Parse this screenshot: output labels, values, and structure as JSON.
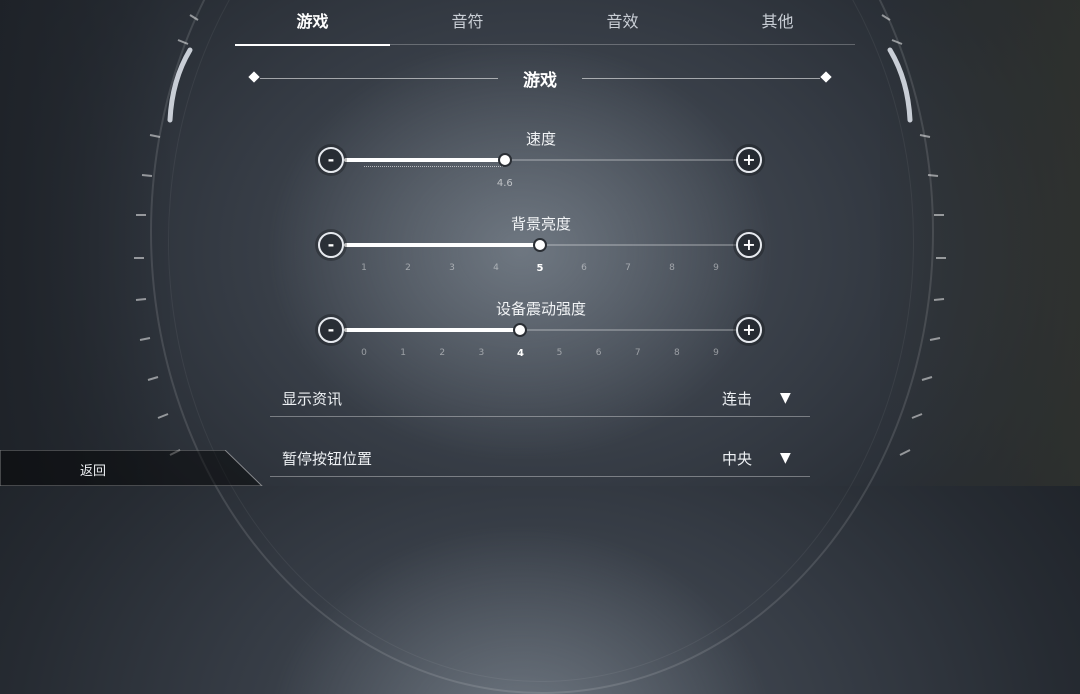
{
  "tabs": [
    {
      "label": "游戏",
      "active": true
    },
    {
      "label": "音符",
      "active": false
    },
    {
      "label": "音效",
      "active": false
    },
    {
      "label": "其他",
      "active": false
    }
  ],
  "section": {
    "title": "游戏"
  },
  "sliders": {
    "speed": {
      "label": "速度",
      "value": 4.6,
      "value_text": "4.6",
      "min": 1,
      "max": 10,
      "minus_label": "-",
      "plus_label": "+"
    },
    "brightness": {
      "label": "背景亮度",
      "value": 5,
      "ticks": [
        "1",
        "2",
        "3",
        "4",
        "5",
        "6",
        "7",
        "8",
        "9"
      ],
      "minus_label": "-",
      "plus_label": "+"
    },
    "vibration": {
      "label": "设备震动强度",
      "value": 4,
      "ticks": [
        "0",
        "1",
        "2",
        "3",
        "4",
        "5",
        "6",
        "7",
        "8",
        "9"
      ],
      "minus_label": "-",
      "plus_label": "+"
    }
  },
  "options": {
    "display_info": {
      "label": "显示资讯",
      "value": "连击"
    },
    "pause_position": {
      "label": "暂停按钮位置",
      "value": "中央"
    }
  },
  "icons": {
    "dropdown": "triangle-down-icon",
    "minus": "minus-icon",
    "plus": "plus-icon",
    "section": "diamond-icon"
  },
  "back": {
    "label": "返回"
  }
}
